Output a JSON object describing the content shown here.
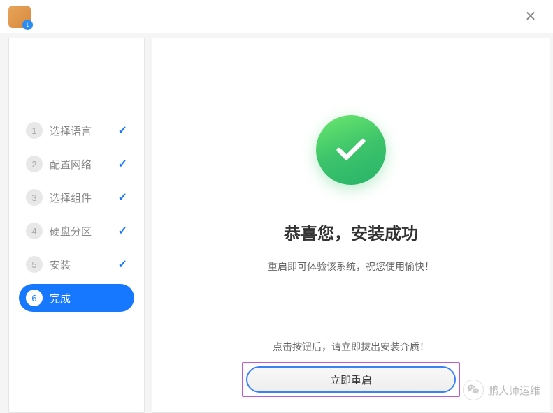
{
  "titlebar": {
    "close": "✕"
  },
  "sidebar": {
    "steps": [
      {
        "num": "1",
        "label": "选择语言",
        "done": true,
        "active": false
      },
      {
        "num": "2",
        "label": "配置网络",
        "done": true,
        "active": false
      },
      {
        "num": "3",
        "label": "选择组件",
        "done": true,
        "active": false
      },
      {
        "num": "4",
        "label": "硬盘分区",
        "done": true,
        "active": false
      },
      {
        "num": "5",
        "label": "安装",
        "done": true,
        "active": false
      },
      {
        "num": "6",
        "label": "完成",
        "done": false,
        "active": true
      }
    ]
  },
  "content": {
    "title": "恭喜您，安装成功",
    "subtitle": "重启即可体验该系统，祝您使用愉快！",
    "hint": "点击按钮后，请立即拔出安装介质！",
    "restart_button": "立即重启"
  },
  "watermark": {
    "text": "鹏大师运维"
  }
}
